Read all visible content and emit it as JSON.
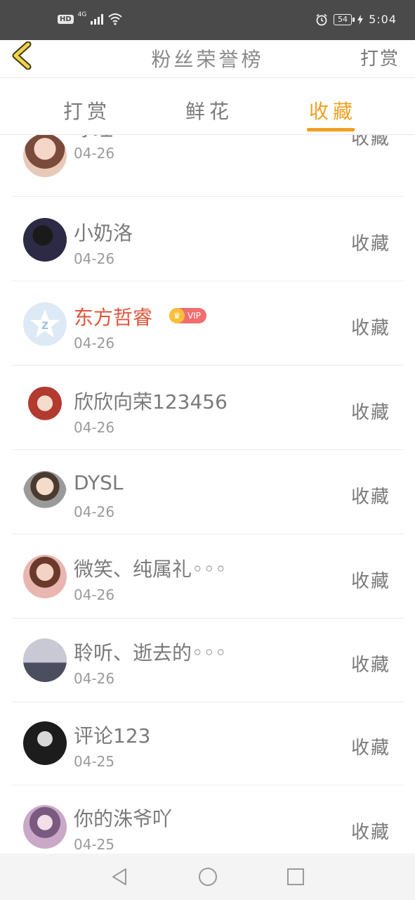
{
  "status_bar": {
    "hd": "HD",
    "network": "4G",
    "battery": "54",
    "time": "5:04"
  },
  "header": {
    "title": "粉丝荣誉榜",
    "right_action": "打赏",
    "back_icon": "chevron-left-icon"
  },
  "tabs": [
    {
      "label": "打赏",
      "active": false
    },
    {
      "label": "鲜花",
      "active": false
    },
    {
      "label": "收藏",
      "active": true
    }
  ],
  "accent_color": "#f0a020",
  "fans": [
    {
      "name": "冰珏",
      "date": "04-26",
      "action": "收藏"
    },
    {
      "name": "小奶洛",
      "date": "04-26",
      "action": "收藏"
    },
    {
      "name": "东方哲睿",
      "date": "04-26",
      "action": "收藏",
      "vip": "VIP"
    },
    {
      "name": "欣欣向荣123456",
      "date": "04-26",
      "action": "收藏"
    },
    {
      "name": "DYSL",
      "date": "04-26",
      "action": "收藏"
    },
    {
      "name": "微笑、纯属礼◦◦◦",
      "date": "04-26",
      "action": "收藏"
    },
    {
      "name": "聆听、逝去的◦◦◦",
      "date": "04-26",
      "action": "收藏"
    },
    {
      "name": "评论123",
      "date": "04-25",
      "action": "收藏"
    },
    {
      "name": "你的洙爷吖",
      "date": "04-25",
      "action": "收藏"
    }
  ]
}
